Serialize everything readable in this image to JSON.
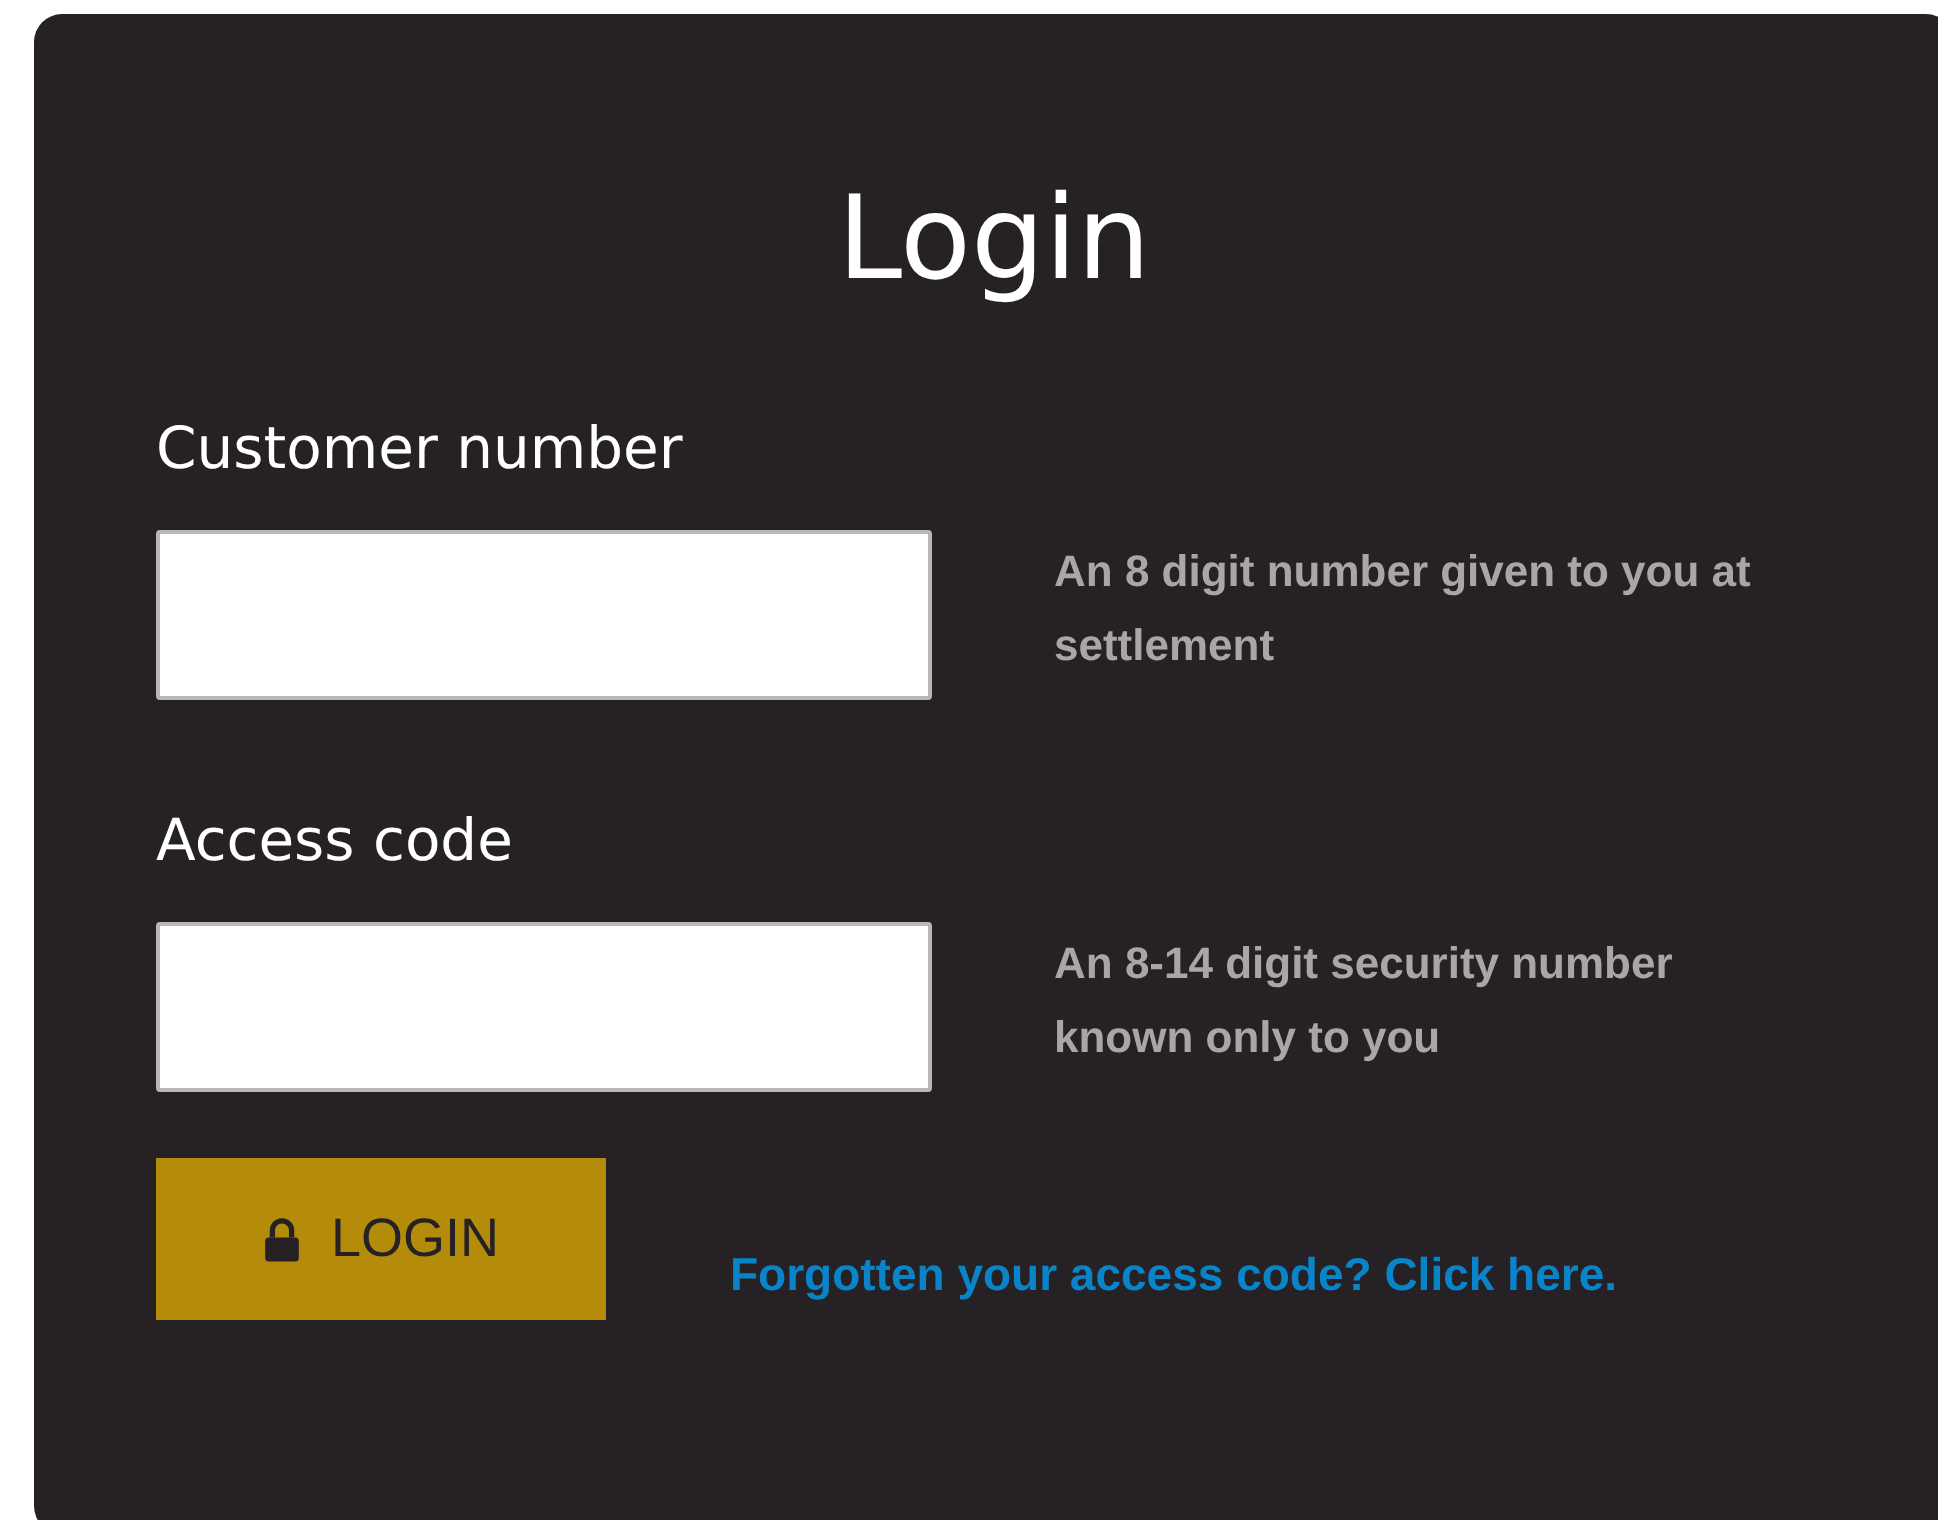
{
  "title": "Login",
  "fields": [
    {
      "label": "Customer number",
      "hint": "An 8 digit number given to you at settlement"
    },
    {
      "label": "Access code",
      "hint": "An 8-14 digit security number known only to you"
    }
  ],
  "login_button": {
    "label": "LOGIN"
  },
  "forgot_link": "Forgotten your access code? Click here."
}
